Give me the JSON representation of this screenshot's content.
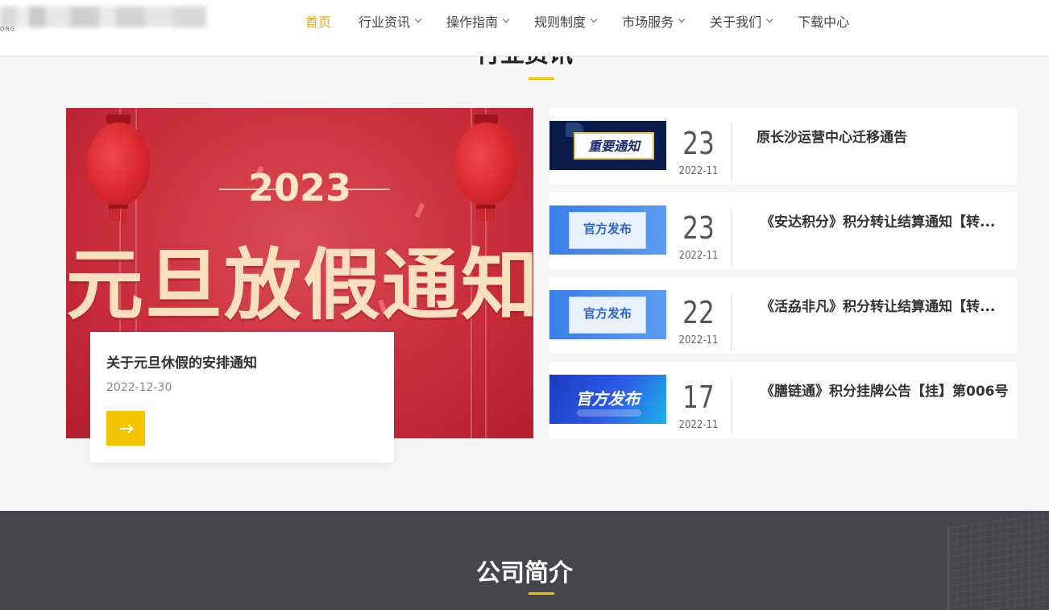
{
  "nav": {
    "items": [
      {
        "label": "首页",
        "active": true,
        "has_dropdown": false
      },
      {
        "label": "行业资讯",
        "active": false,
        "has_dropdown": true
      },
      {
        "label": "操作指南",
        "active": false,
        "has_dropdown": true
      },
      {
        "label": "规则制度",
        "active": false,
        "has_dropdown": true
      },
      {
        "label": "市场服务",
        "active": false,
        "has_dropdown": true
      },
      {
        "label": "关于我们",
        "active": false,
        "has_dropdown": true
      },
      {
        "label": "下载中心",
        "active": false,
        "has_dropdown": false
      }
    ],
    "active_color": "#e8a317"
  },
  "news_section": {
    "title": "行业资讯",
    "featured": {
      "image_year": "2023",
      "image_headline": "元旦放假通知",
      "title": "关于元旦休假的安排通知",
      "date": "2022-12-30",
      "arrow_icon": "arrow-right-icon"
    },
    "items": [
      {
        "thumb_text": "重要通知",
        "day": "23",
        "ym": "2022-11",
        "title": "原长沙运营中心迁移通告"
      },
      {
        "thumb_text": "官方发布",
        "day": "23",
        "ym": "2022-11",
        "title": "《安达积分》积分转让结算通知【转..."
      },
      {
        "thumb_text": "官方发布",
        "day": "22",
        "ym": "2022-11",
        "title": "《活劦非凡》积分转让结算通知【转..."
      },
      {
        "thumb_text": "官方发布",
        "day": "17",
        "ym": "2022-11",
        "title": "《膳链通》积分挂牌公告【挂】第006号"
      }
    ]
  },
  "company_section": {
    "title": "公司简介"
  },
  "colors": {
    "accent": "#f5c400",
    "banner_red": "#c92c3a",
    "company_bg": "#45454b"
  }
}
